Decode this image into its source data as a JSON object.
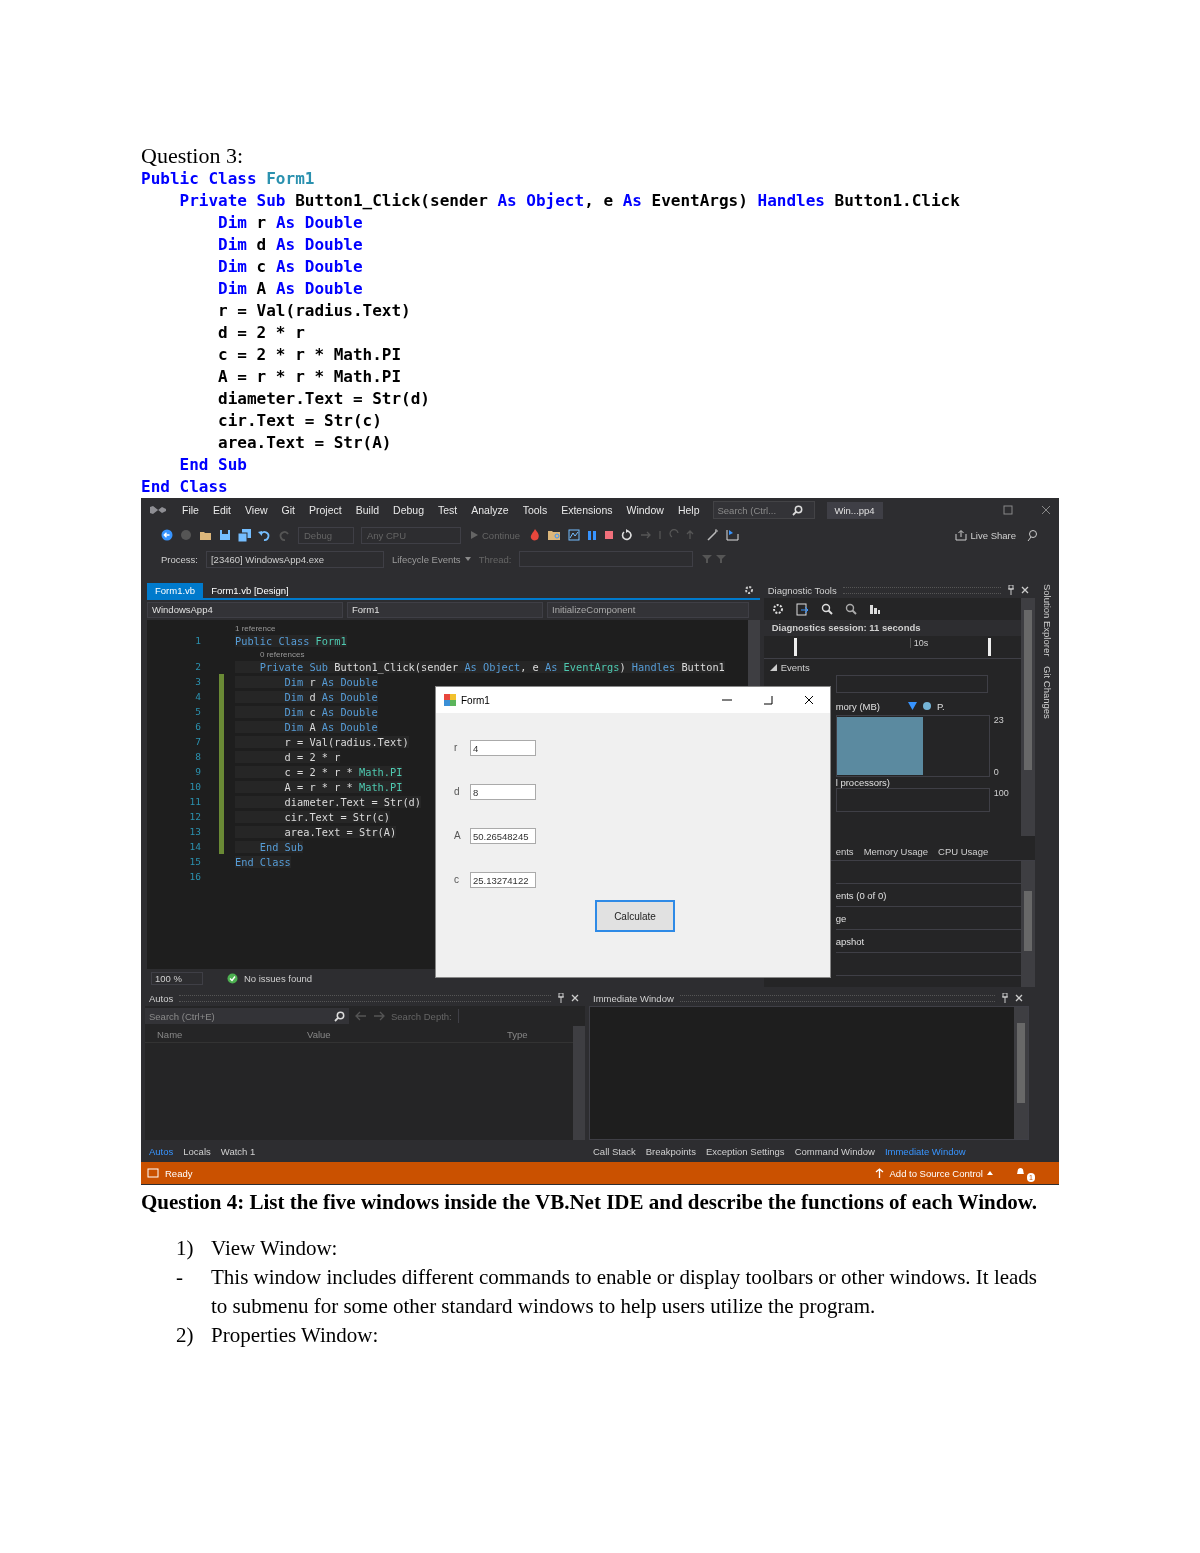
{
  "question3": {
    "heading": "Question 3:",
    "code": [
      {
        "tokens": [
          {
            "kind": "kw",
            "text": "Public Class"
          },
          {
            "kind": "type",
            "text": " Form1"
          }
        ]
      },
      {
        "tokens": [
          {
            "kind": "kw",
            "text": "    Private Sub"
          },
          {
            "kind": "plain",
            "text": " Button1_Click(sender "
          },
          {
            "kind": "kw",
            "text": "As Object"
          },
          {
            "kind": "plain",
            "text": ", e "
          },
          {
            "kind": "kw",
            "text": "As"
          },
          {
            "kind": "plain",
            "text": " EventArgs) "
          },
          {
            "kind": "kw",
            "text": "Handles"
          },
          {
            "kind": "plain",
            "text": " Button1.Click"
          }
        ]
      },
      {
        "tokens": [
          {
            "kind": "kw",
            "text": "        Dim"
          },
          {
            "kind": "plain",
            "text": " r "
          },
          {
            "kind": "kw",
            "text": "As Double"
          }
        ]
      },
      {
        "tokens": [
          {
            "kind": "kw",
            "text": "        Dim"
          },
          {
            "kind": "plain",
            "text": " d "
          },
          {
            "kind": "kw",
            "text": "As Double"
          }
        ]
      },
      {
        "tokens": [
          {
            "kind": "kw",
            "text": "        Dim"
          },
          {
            "kind": "plain",
            "text": " c "
          },
          {
            "kind": "kw",
            "text": "As Double"
          }
        ]
      },
      {
        "tokens": [
          {
            "kind": "kw",
            "text": "        Dim"
          },
          {
            "kind": "plain",
            "text": " A "
          },
          {
            "kind": "kw",
            "text": "As Double"
          }
        ]
      },
      {
        "tokens": [
          {
            "kind": "plain",
            "text": "        r = Val(radius.Text)"
          }
        ]
      },
      {
        "tokens": [
          {
            "kind": "plain",
            "text": "        d = 2 * r"
          }
        ]
      },
      {
        "tokens": [
          {
            "kind": "plain",
            "text": "        c = 2 * r * Math.PI"
          }
        ]
      },
      {
        "tokens": [
          {
            "kind": "plain",
            "text": "        A = r * r * Math.PI"
          }
        ]
      },
      {
        "tokens": [
          {
            "kind": "plain",
            "text": "        diameter.Text = Str(d)"
          }
        ]
      },
      {
        "tokens": [
          {
            "kind": "plain",
            "text": "        cir.Text = Str(c)"
          }
        ]
      },
      {
        "tokens": [
          {
            "kind": "plain",
            "text": "        area.Text = Str(A)"
          }
        ]
      },
      {
        "tokens": [
          {
            "kind": "kw",
            "text": "    End Sub"
          }
        ]
      },
      {
        "tokens": [
          {
            "kind": "kw",
            "text": "End Class"
          }
        ]
      }
    ]
  },
  "ide": {
    "menu": [
      "File",
      "Edit",
      "View",
      "Git",
      "Project",
      "Build",
      "Debug",
      "Test",
      "Analyze",
      "Tools",
      "Extensions",
      "Window",
      "Help"
    ],
    "search": {
      "placeholder": "Search (Ctrl..."
    },
    "solution_badge": "Win...pp4",
    "toolbar": {
      "configuration": "Debug",
      "platform": "Any CPU",
      "continue": "Continue",
      "live_share": "Live Share"
    },
    "debug_bar": {
      "process_label": "Process:",
      "process": "[23460] WindowsApp4.exe",
      "lifecycle": "Lifecycle Events",
      "thread_label": "Thread:"
    },
    "editor": {
      "tabs": [
        {
          "label": "Form1.vb",
          "selected": true
        },
        {
          "label": "Form1.vb [Design]",
          "selected": false
        }
      ],
      "nav": [
        "WindowsApp4",
        "Form1",
        "InitializeComponent"
      ],
      "lines": [
        {
          "number": "1",
          "codelens": "1 reference",
          "tokens": [
            {
              "kind": "kw",
              "text": "Public Class"
            },
            {
              "kind": "type",
              "text": " Form1"
            }
          ]
        },
        {
          "number": "2",
          "codelens": "0 references",
          "tokens": [
            {
              "kind": "kw",
              "text": "    Private Sub"
            },
            {
              "kind": "plain",
              "text": " Button1_Click(sender "
            },
            {
              "kind": "kw",
              "text": "As Object"
            },
            {
              "kind": "plain",
              "text": ", e "
            },
            {
              "kind": "kw",
              "text": "As"
            },
            {
              "kind": "type",
              "text": " EventArgs"
            },
            {
              "kind": "plain",
              "text": ") "
            },
            {
              "kind": "kw",
              "text": "Handles"
            },
            {
              "kind": "plain",
              "text": " Button1"
            }
          ]
        },
        {
          "number": "3",
          "tokens": [
            {
              "kind": "kw",
              "text": "        Dim"
            },
            {
              "kind": "plain",
              "text": " r "
            },
            {
              "kind": "kw",
              "text": "As Double"
            }
          ]
        },
        {
          "number": "4",
          "tokens": [
            {
              "kind": "kw",
              "text": "        Dim"
            },
            {
              "kind": "plain",
              "text": " d "
            },
            {
              "kind": "kw",
              "text": "As Double"
            }
          ]
        },
        {
          "number": "5",
          "tokens": [
            {
              "kind": "kw",
              "text": "        Dim"
            },
            {
              "kind": "plain",
              "text": " c "
            },
            {
              "kind": "kw",
              "text": "As Double"
            }
          ]
        },
        {
          "number": "6",
          "tokens": [
            {
              "kind": "kw",
              "text": "        Dim"
            },
            {
              "kind": "plain",
              "text": " A "
            },
            {
              "kind": "kw",
              "text": "As Double"
            }
          ]
        },
        {
          "number": "7",
          "tokens": [
            {
              "kind": "plain",
              "text": "        r = Val(radius.Text)"
            }
          ]
        },
        {
          "number": "8",
          "tokens": [
            {
              "kind": "plain",
              "text": "        d = 2 * r"
            }
          ]
        },
        {
          "number": "9",
          "tokens": [
            {
              "kind": "plain",
              "text": "        c = 2 * r * "
            },
            {
              "kind": "type",
              "text": "Math.PI"
            }
          ]
        },
        {
          "number": "10",
          "tokens": [
            {
              "kind": "plain",
              "text": "        A = r * r * "
            },
            {
              "kind": "type",
              "text": "Math.PI"
            }
          ]
        },
        {
          "number": "11",
          "tokens": [
            {
              "kind": "plain",
              "text": "        diameter.Text = Str(d)"
            }
          ]
        },
        {
          "number": "12",
          "tokens": [
            {
              "kind": "plain",
              "text": "        cir.Text = Str(c)"
            }
          ]
        },
        {
          "number": "13",
          "tokens": [
            {
              "kind": "plain",
              "text": "        area.Text = Str(A)"
            }
          ]
        },
        {
          "number": "14",
          "tokens": [
            {
              "kind": "kw",
              "text": "    End Sub"
            }
          ]
        },
        {
          "number": "15",
          "tokens": [
            {
              "kind": "kw",
              "text": "End Class"
            }
          ]
        },
        {
          "number": "16"
        }
      ],
      "zoom": "100 %",
      "issues": "No issues found"
    },
    "diagnostics": {
      "title": "Diagnostic Tools",
      "session": "Diagnostics session: 11 seconds",
      "tick": "10s",
      "events": "Events",
      "memory_label": "mory (MB)",
      "legend": "P.",
      "memory_max": "23",
      "memory_min": "0",
      "cpu_label": "l processors)",
      "cpu_max": "100",
      "tabs": [
        "ents",
        "Memory Usage",
        "CPU Usage"
      ],
      "rows": [
        "",
        "ents (0 of 0)",
        "ge",
        "apshot",
        ""
      ]
    },
    "side_tabs": [
      "Solution Explorer",
      "Git Changes"
    ],
    "autos": {
      "title": "Autos",
      "search": {
        "placeholder": "Search (Ctrl+E)"
      },
      "search_depth": "Search Depth:",
      "columns": [
        "Name",
        "Value",
        "Type"
      ],
      "tabs": [
        {
          "label": "Autos",
          "selected": true
        },
        {
          "label": "Locals",
          "selected": false
        },
        {
          "label": "Watch 1",
          "selected": false
        }
      ]
    },
    "immediate": {
      "title": "Immediate Window",
      "tabs": [
        {
          "label": "Call Stack",
          "selected": false
        },
        {
          "label": "Breakpoints",
          "selected": false
        },
        {
          "label": "Exception Settings",
          "selected": false
        },
        {
          "label": "Command Window",
          "selected": false
        },
        {
          "label": "Immediate Window",
          "selected": true
        }
      ]
    },
    "status_bar": {
      "state": "Ready",
      "source_control": "Add to Source Control",
      "notifications": "1"
    },
    "form": {
      "title": "Form1",
      "fields": [
        {
          "label": "r",
          "value": "4"
        },
        {
          "label": "d",
          "value": "8"
        },
        {
          "label": "A",
          "value": "50.26548245"
        },
        {
          "label": "c",
          "value": "25.13274122"
        }
      ],
      "button": "Calculate"
    }
  },
  "question4": {
    "heading": "Question 4: List the five windows inside the VB.Net IDE and describe the functions of each Window.",
    "items": [
      {
        "marker": "1)",
        "text": "View Window:"
      },
      {
        "marker": "-",
        "text": "This window includes different commands to enable or display toolbars or other windows. It leads to submenu for some other standard windows to help users utilize the program."
      },
      {
        "marker": "2)",
        "text": "Properties Window:"
      }
    ]
  }
}
